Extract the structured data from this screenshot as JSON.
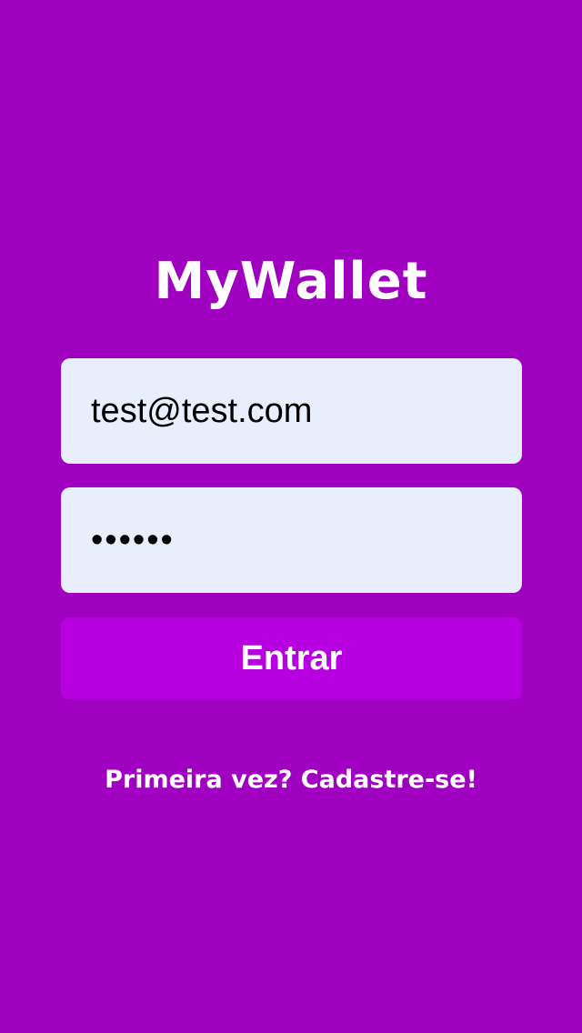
{
  "app": {
    "logo_text": "MyWallet"
  },
  "login_form": {
    "email_value": "test@test.com",
    "password_value": "••••••",
    "submit_label": "Entrar"
  },
  "signup": {
    "link_text": "Primeira vez? Cadastre-se!"
  },
  "colors": {
    "background": "#a000c0",
    "button": "#b600df",
    "input_background": "#e8eefb",
    "text_light": "#ffffff"
  }
}
